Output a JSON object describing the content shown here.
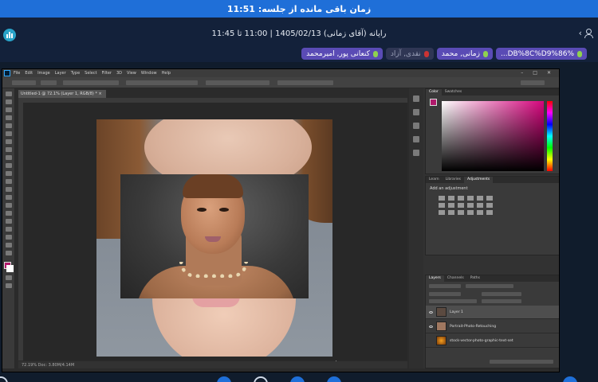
{
  "banner": {
    "label": "زمان باقی مانده از جلسه:",
    "time": "11:51"
  },
  "session": {
    "title": "رایانه (آقای زمانی) 1405/02/13 | 11:00 تا 11:45",
    "user_nav": "‹"
  },
  "participants": [
    {
      "name": "DB%8C%D9%86%...",
      "active": true
    },
    {
      "name": "زمانی, محمد",
      "active": true
    },
    {
      "name": "نقدی, آزاد",
      "active": false
    },
    {
      "name": "کنعانی پور, امیرمحمد",
      "active": true
    }
  ],
  "photoshop": {
    "menu": [
      "File",
      "Edit",
      "Image",
      "Layer",
      "Type",
      "Select",
      "Filter",
      "3D",
      "View",
      "Window",
      "Help"
    ],
    "window_buttons": [
      "–",
      "□",
      "✕"
    ],
    "document_tab": "Untitled-1 @ 72.1% (Layer 1, RGB/8) * ×",
    "status": "72.19%    Doc: 3.80M/4.14M",
    "panels": {
      "color_tabs": [
        "Color",
        "Swatches"
      ],
      "adjust_tabs": [
        "Learn",
        "Libraries",
        "Adjustments"
      ],
      "adjust_label": "Add an adjustment",
      "layer_tabs": [
        "Layers",
        "Channels",
        "Paths"
      ],
      "layers": [
        {
          "name": "Layer 1",
          "selected": true
        },
        {
          "name": "Portrait-Photo-Retouching",
          "selected": false
        },
        {
          "name": "stock-vector-photo-graphic-text-set",
          "selected": false
        }
      ]
    },
    "colors": {
      "foreground": "#b0196b",
      "background": "#ffffff"
    }
  },
  "colors": {
    "accent": "#1f6fd8",
    "chip_active": "#5a4bb5",
    "chip_inactive": "#2f3654"
  }
}
